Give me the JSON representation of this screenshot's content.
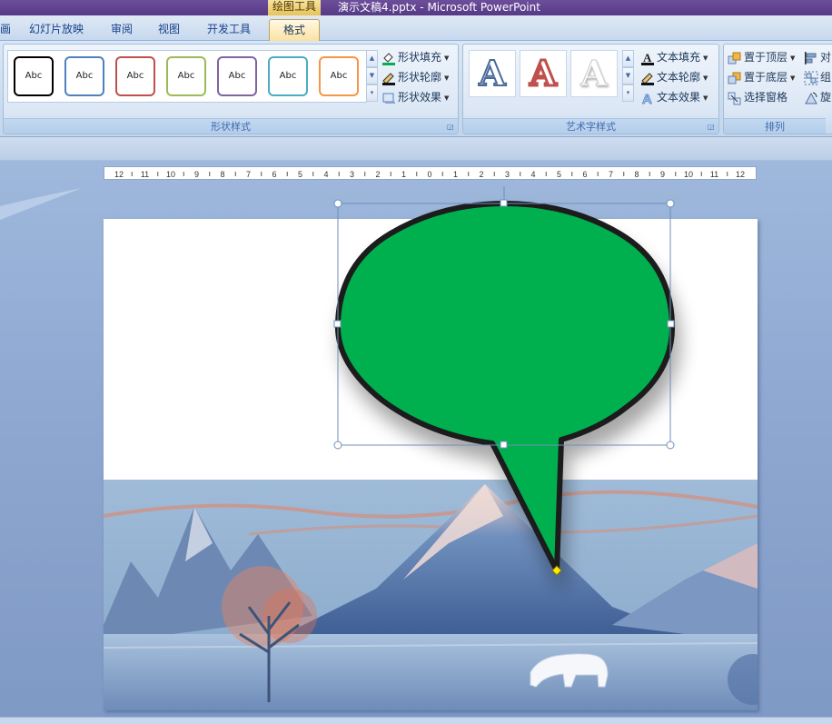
{
  "titlebar": {
    "context_tab": "绘图工具",
    "title": "演示文稿4.pptx - Microsoft PowerPoint"
  },
  "tabs": [
    {
      "label": "画"
    },
    {
      "label": "幻灯片放映"
    },
    {
      "label": "审阅"
    },
    {
      "label": "视图"
    },
    {
      "label": "开发工具"
    },
    {
      "label": "格式",
      "active": true
    }
  ],
  "ribbon": {
    "shape_styles": {
      "label": "形状样式",
      "swatches": [
        {
          "text": "Abc",
          "color": "#000000"
        },
        {
          "text": "Abc",
          "color": "#4f81bd"
        },
        {
          "text": "Abc",
          "color": "#c0504d"
        },
        {
          "text": "Abc",
          "color": "#9bbb59"
        },
        {
          "text": "Abc",
          "color": "#8064a2"
        },
        {
          "text": "Abc",
          "color": "#4bacc6"
        },
        {
          "text": "Abc",
          "color": "#f79646"
        }
      ],
      "fill": "形状填充",
      "outline": "形状轮廓",
      "effects": "形状效果"
    },
    "wordart": {
      "label": "艺术字样式",
      "samples": [
        {
          "letter": "A",
          "style": "outline-blue"
        },
        {
          "letter": "A",
          "style": "outline-red"
        },
        {
          "letter": "A",
          "style": "white-shadow"
        }
      ],
      "text_fill": "文本填充",
      "text_outline": "文本轮廓",
      "text_effects": "文本效果"
    },
    "arrange": {
      "label": "排列",
      "bring_front": "置于顶层",
      "send_back": "置于底层",
      "selection_pane": "选择窗格",
      "align": "对",
      "group": "组",
      "rotate": "旋"
    }
  },
  "ruler": {
    "labels": [
      "12",
      "11",
      "10",
      "9",
      "8",
      "7",
      "6",
      "5",
      "4",
      "3",
      "2",
      "1",
      "0",
      "1",
      "2",
      "3",
      "4",
      "5",
      "6",
      "7",
      "8",
      "9",
      "10",
      "11",
      "12"
    ]
  },
  "slide": {
    "callout": {
      "shape": "oval-callout",
      "fill": "#00b050",
      "outline": "#1a1a1a"
    },
    "scene": {
      "sky": "#8fb0cf",
      "mountains": "#5a7fb0",
      "accent": "#e8825e"
    }
  },
  "colors": {
    "ribbon_bg": "#dae6f4",
    "title_purple": "#5e4190",
    "selection_handle": "#ffffff",
    "adjust_handle": "#ffe900"
  }
}
